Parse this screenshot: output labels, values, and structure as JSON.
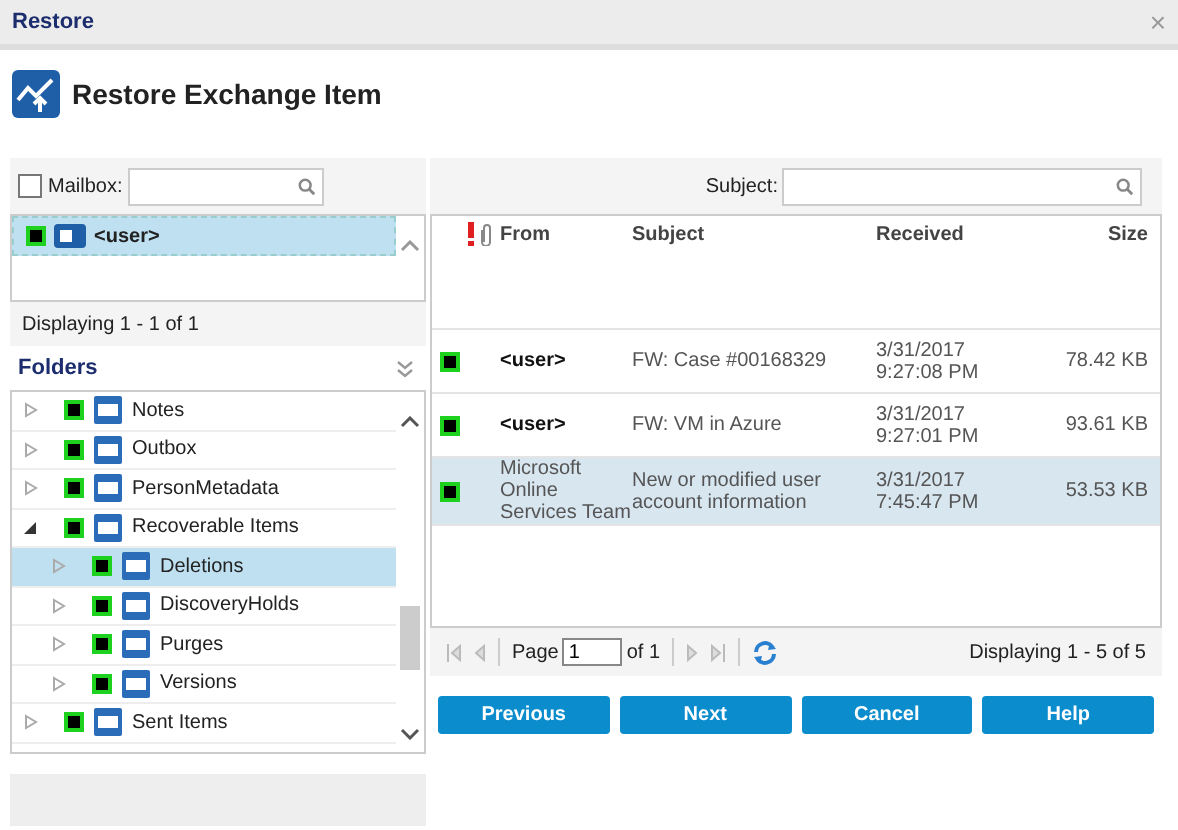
{
  "window": {
    "title": "Restore",
    "close": "×"
  },
  "header": {
    "title": "Restore Exchange Item"
  },
  "mailbox_filter": {
    "checked": false,
    "label": "Mailbox:"
  },
  "mailboxes": [
    {
      "name": "<user>",
      "checked": true,
      "selected": true
    }
  ],
  "mailbox_status": "Displaying 1 - 1 of 1",
  "folders": {
    "title": "Folders",
    "items": [
      {
        "name": "Notes",
        "checked": true,
        "expanded": false,
        "selected": false
      },
      {
        "name": "Outbox",
        "checked": true,
        "expanded": false,
        "selected": false
      },
      {
        "name": "PersonMetadata",
        "checked": true,
        "expanded": false,
        "selected": false
      },
      {
        "name": "Recoverable Items",
        "checked": true,
        "expanded": true,
        "selected": false,
        "children": [
          {
            "name": "Deletions",
            "checked": true,
            "expanded": false,
            "selected": true
          },
          {
            "name": "DiscoveryHolds",
            "checked": true,
            "expanded": false,
            "selected": false
          },
          {
            "name": "Purges",
            "checked": true,
            "expanded": false,
            "selected": false
          },
          {
            "name": "Versions",
            "checked": true,
            "expanded": false,
            "selected": false
          }
        ]
      },
      {
        "name": "Sent Items",
        "checked": true,
        "expanded": false,
        "selected": false
      }
    ]
  },
  "subject_filter": {
    "label": "Subject:"
  },
  "messages": {
    "columns": [
      "From",
      "Subject",
      "Received",
      "Size"
    ],
    "rows": [
      {
        "from": "<user>",
        "subject": "FW: Case #00168329",
        "received": "3/31/2017 9:27:08 PM",
        "size": "78.42 KB",
        "checked": true,
        "selected": false
      },
      {
        "from": "<user>",
        "subject": "FW: VM in Azure",
        "received": "3/31/2017 9:27:01 PM",
        "size": "93.61 KB",
        "checked": true,
        "selected": false
      },
      {
        "from": "Microsoft Online Services Team",
        "subject": "New or modified user account information",
        "received": "3/31/2017 7:45:47 PM",
        "size": "53.53 KB",
        "checked": true,
        "selected": true
      }
    ]
  },
  "pager": {
    "page_label": "Page",
    "page": "1",
    "of": "of 1",
    "status": "Displaying 1 - 5 of 5"
  },
  "buttons": [
    "Previous",
    "Next",
    "Cancel",
    "Help"
  ]
}
